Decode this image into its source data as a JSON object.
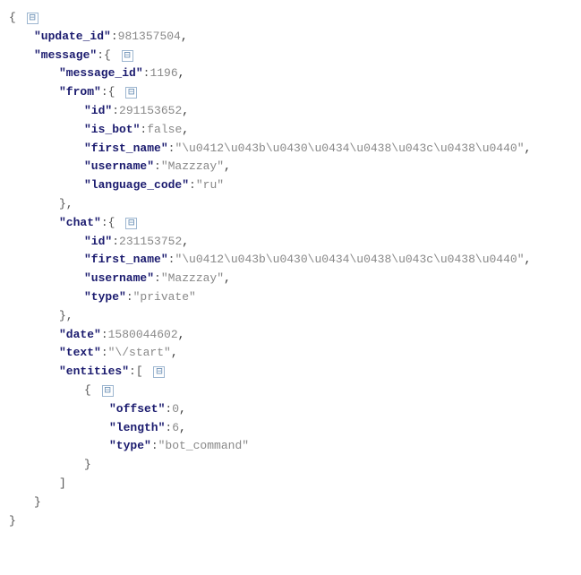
{
  "root": {
    "open_brace": "{",
    "close_brace": "}",
    "collapse": "⊟",
    "update_id_key": "\"update_id\"",
    "update_id_val": "981357504",
    "message_key": "\"message\"",
    "message": {
      "open": "{",
      "close": "}",
      "collapse": "⊟",
      "message_id_key": "\"message_id\"",
      "message_id_val": "1196",
      "from_key": "\"from\"",
      "from": {
        "open": "{",
        "close": "}",
        "collapse": "⊟",
        "id_key": "\"id\"",
        "id_val": "291153652",
        "is_bot_key": "\"is_bot\"",
        "is_bot_val": "false",
        "first_name_key": "\"first_name\"",
        "first_name_val": "\"\\u0412\\u043b\\u0430\\u0434\\u0438\\u043c\\u0438\\u0440\"",
        "username_key": "\"username\"",
        "username_val": "\"Mazzzay\"",
        "language_code_key": "\"language_code\"",
        "language_code_val": "\"ru\""
      },
      "chat_key": "\"chat\"",
      "chat": {
        "open": "{",
        "close": "}",
        "collapse": "⊟",
        "id_key": "\"id\"",
        "id_val": "231153752",
        "first_name_key": "\"first_name\"",
        "first_name_val": "\"\\u0412\\u043b\\u0430\\u0434\\u0438\\u043c\\u0438\\u0440\"",
        "username_key": "\"username\"",
        "username_val": "\"Mazzzay\"",
        "type_key": "\"type\"",
        "type_val": "\"private\""
      },
      "date_key": "\"date\"",
      "date_val": "1580044602",
      "text_key": "\"text\"",
      "text_val": "\"\\/start\"",
      "entities_key": "\"entities\"",
      "entities": {
        "open": "[",
        "close": "]",
        "collapse": "⊟",
        "item0": {
          "open": "{",
          "close": "}",
          "collapse": "⊟",
          "offset_key": "\"offset\"",
          "offset_val": "0",
          "length_key": "\"length\"",
          "length_val": "6",
          "type_key": "\"type\"",
          "type_val": "\"bot_command\""
        }
      }
    }
  },
  "punct": {
    "colon": ":",
    "comma": ",",
    "close_brace_comma": "},",
    "close_bracket": "]"
  }
}
